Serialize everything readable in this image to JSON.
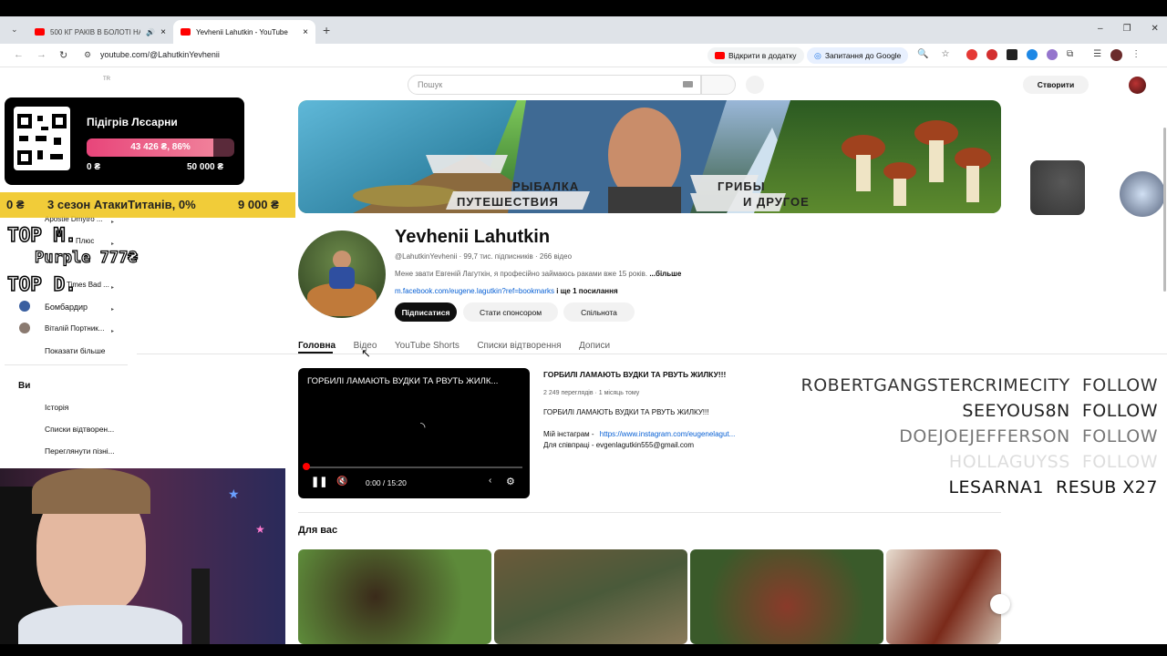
{
  "browser": {
    "tab1_title": "500 КГ РАКІВ В БОЛОТІ НА",
    "tab2_title": "Yevhenii Lahutkin - YouTube",
    "new_tab": "+",
    "url": "youtube.com/@LahutkinYevhenii",
    "open_in_app": "Відкрити в додатку",
    "ask_google": "Запитання до Google"
  },
  "yt": {
    "search_placeholder": "Пошук",
    "create": "Створити",
    "tr_badge": "TR"
  },
  "channel": {
    "name": "Yevhenii Lahutkin",
    "meta": "@LahutkinYevhenii · 99,7 тис. підписників · 266 відео",
    "description": "Мене звати Евгеній Лагуткін, я професійно займаюсь раками вже  15 років.",
    "more": "...більше",
    "link": "m.facebook.com/eugene.lagutkin?ref=bookmarks",
    "more_links": "і ще 1 посилання",
    "subscribe": "Підписатися",
    "sponsor": "Стати спонсором",
    "community": "Спільнота",
    "banner_left1": "РЫБАЛКА",
    "banner_left2": "ПУТЕШЕСТВИЯ",
    "banner_right1": "ГРИБЫ",
    "banner_right2": "И ДРУГОЕ"
  },
  "tabs": [
    "Головна",
    "Відео",
    "YouTube Shorts",
    "Списки відтворення",
    "Дописи"
  ],
  "featured": {
    "player_title": "ГОРБИЛІ ЛАМАЮТЬ ВУДКИ ТА РВУТЬ ЖИЛК...",
    "time": "0:00 / 15:20",
    "title": "ГОРБИЛІ ЛАМАЮТЬ ВУДКИ ТА РВУТЬ ЖИЛКУ!!!",
    "stats": "2 249 переглядів · 1 місяць тому",
    "desc1": "ГОРБИЛІ ЛАМАЮТЬ ВУДКИ ТА РВУТЬ ЖИЛКУ!!!",
    "desc2_label": "Мій інстаграм -",
    "desc2_link": "https://www.instagram.com/eugenelagut...",
    "desc3": "Для співпраці - evgenlagutkin555@gmail.com",
    "progress": 0.0
  },
  "for_you": "Для вас",
  "sidebar": {
    "items": [
      "Apostle Dmytro ...",
      "Плюс",
      "Times Bad ...",
      "Бомбардир",
      "Віталій Портник..."
    ],
    "show_more": "Показати більше",
    "you": "Ви",
    "history": "Історія",
    "playlists": "Списки відтворен...",
    "watch_later": "Переглянути пізні..."
  },
  "overlay": {
    "donate_title": "Підігрів Лєсарни",
    "donate_amount": "43 426 ₴, 86%",
    "donate_progress": 0.86,
    "donate_min": "0 ₴",
    "donate_max": "50 000 ₴",
    "goal2_left": "0 ₴",
    "goal2_title": "3 сезон АтакиТитанів, 0%",
    "goal2_right": "9 000 ₴",
    "top_m": "TOP M.",
    "top_m_name": "Purple 777₴",
    "top_d": "TOP D.",
    "feed": [
      {
        "name": "ROBERTGANGSTERCRIMECITY",
        "action": "FOLLOW"
      },
      {
        "name": "SEEYOUS8N",
        "action": "FOLLOW"
      },
      {
        "name": "DOEJOEJEFFERSON",
        "action": "FOLLOW"
      },
      {
        "name": "HOLLAGUYSS",
        "action": "FOLLOW"
      },
      {
        "name": "LESARNA1",
        "action": "RESUB X27"
      }
    ]
  },
  "colors": {
    "accent": "#ff0000",
    "yt_link": "#065fd4",
    "donate_bar": "#e84a6f",
    "goal_yellow": "#f4d03f"
  }
}
